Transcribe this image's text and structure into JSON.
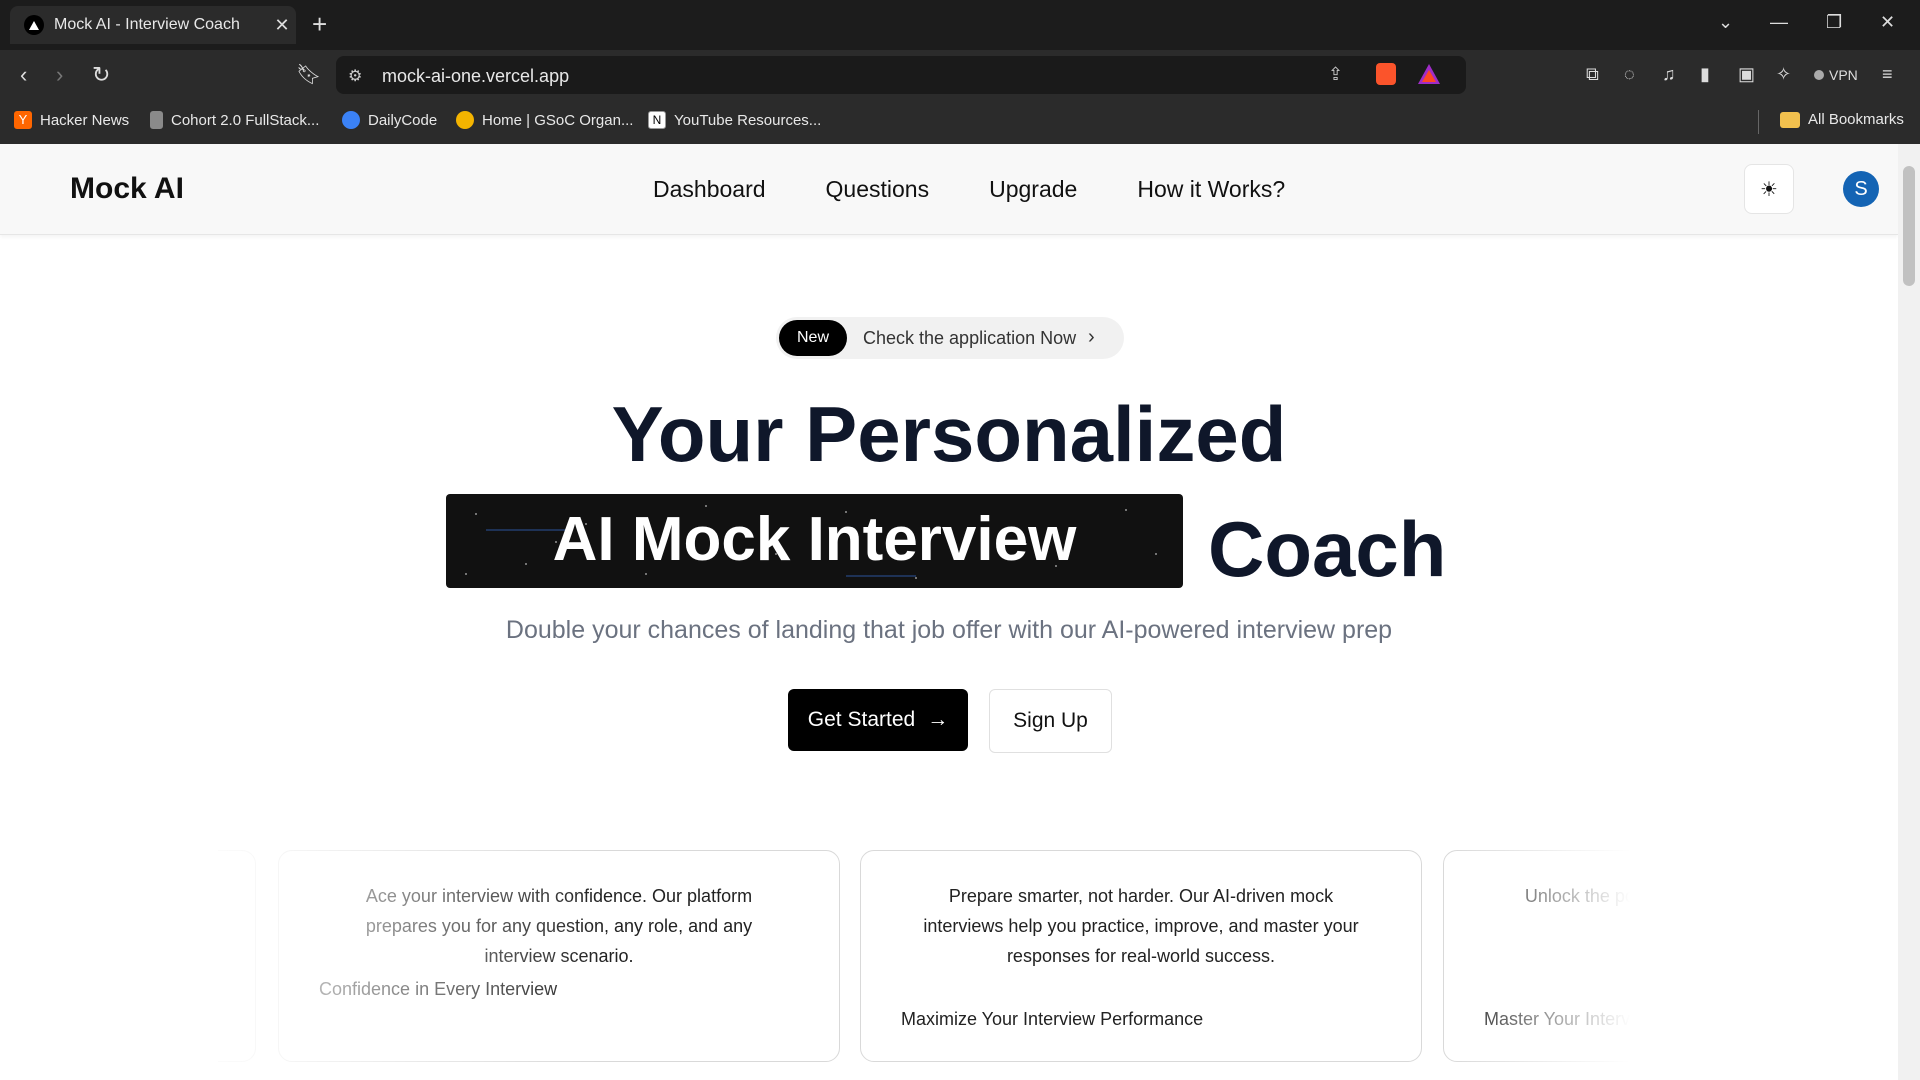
{
  "browser": {
    "tab_title": "Mock AI - Interview Coach",
    "url": "mock-ai-one.vercel.app",
    "vpn_label": "VPN",
    "bookmarks": [
      {
        "label": "Hacker News",
        "icon": "hacker-news-icon",
        "color": "#ff6600"
      },
      {
        "label": "Cohort 2.0 FullStack...",
        "icon": "page-icon",
        "color": "#8a8a8a"
      },
      {
        "label": "DailyCode",
        "icon": "dailycode-icon",
        "color": "#3b82f6"
      },
      {
        "label": "Home | GSoC Organ...",
        "icon": "gsoc-icon",
        "color": "#f4b400"
      },
      {
        "label": "YouTube Resources...",
        "icon": "notion-icon",
        "color": "#ffffff"
      }
    ],
    "all_bookmarks_label": "All Bookmarks"
  },
  "site": {
    "logo": "Mock AI",
    "nav": [
      "Dashboard",
      "Questions",
      "Upgrade",
      "How it Works?"
    ],
    "avatar_initial": "S",
    "avatar_color": "#1464b4"
  },
  "hero": {
    "badge": "New",
    "badge_text": "Check the application Now",
    "title_line1": "Your Personalized",
    "highlight": "AI Mock Interview",
    "title_word": "Coach",
    "subtitle": "Double your chances of landing that job offer with our AI-powered interview prep",
    "primary_button": "Get Started",
    "secondary_button": "Sign Up"
  },
  "cards": [
    {
      "body": "Ace your interview with confidence. Our platform prepares you for any question, any role, and any interview scenario.",
      "title": "Confidence in Every Interview"
    },
    {
      "body": "Prepare smarter, not harder. Our AI-driven mock interviews help you practice, improve, and master your responses for real-world success.",
      "title": "Maximize Your Interview Performance"
    },
    {
      "body": "Unlock the potential of personalized feedback and tailored strategies.",
      "title": "Master Your Interview Skills"
    }
  ]
}
